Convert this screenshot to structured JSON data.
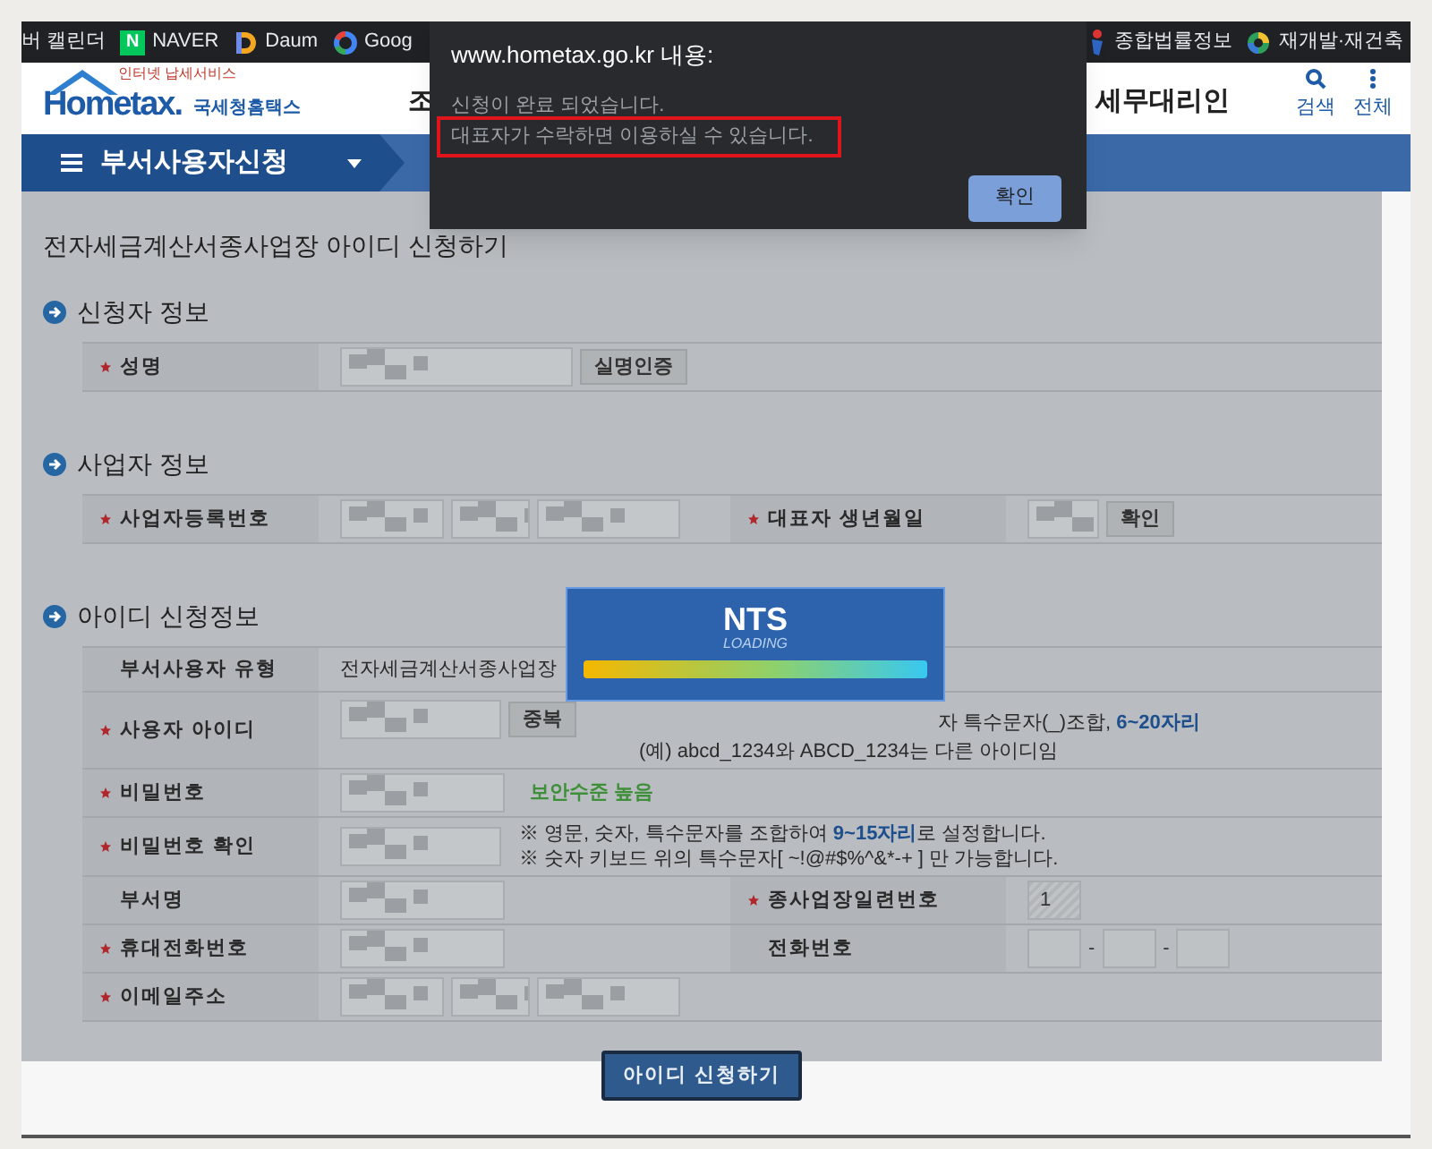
{
  "bookmarks": [
    {
      "label": "버 캘린더",
      "kind": "plain"
    },
    {
      "label": "NAVER",
      "kind": "naver",
      "badge": "N"
    },
    {
      "label": "Daum",
      "kind": "daum"
    },
    {
      "label": "Goog",
      "kind": "google"
    },
    {
      "label": "종합법률정보",
      "kind": "law"
    },
    {
      "label": "재개발·재건축",
      "kind": "swirl"
    }
  ],
  "header": {
    "tagline": "인터넷 납세서비스",
    "logo": "Hometax.",
    "logo_korean": "국세청홈택스",
    "menu": [
      "조",
      "세무대리인"
    ],
    "tools": [
      {
        "label": "검색",
        "kind": "search"
      },
      {
        "label": "전체",
        "kind": "more"
      }
    ]
  },
  "nav": {
    "title": "부서사용자신청"
  },
  "page": {
    "title": "전자세금계산서종사업장 아이디 신청하기",
    "sections": [
      {
        "title": "신청자 정보",
        "rows": [
          {
            "cells": [
              {
                "label": "성명",
                "required": true,
                "value": {
                  "kind": "masked",
                  "button": "실명인증"
                }
              }
            ]
          }
        ]
      },
      {
        "title": "사업자 정보",
        "rows": [
          {
            "cells": [
              {
                "label": "사업자등록번호",
                "required": true,
                "value": {
                  "kind": "masked_group"
                }
              },
              {
                "label": "대표자 생년월일",
                "required": true,
                "value": {
                  "kind": "masked",
                  "button": "확인"
                }
              }
            ]
          }
        ]
      },
      {
        "title": "아이디 신청정보",
        "rows": [
          {
            "cells": [
              {
                "label": "부서사용자 유형",
                "required": false,
                "value": {
                  "kind": "text",
                  "text": "전자세금계산서종사업장"
                }
              }
            ]
          },
          {
            "cells": [
              {
                "label": "사용자 아이디",
                "required": true,
                "value": {
                  "kind": "masked",
                  "button": "중복",
                  "hints": [
                    "자 특수문자(_)조합, **6~20자리**",
                    "(예) abcd_1234와  ABCD_1234는 다른 아이디임"
                  ]
                }
              }
            ]
          },
          {
            "cells": [
              {
                "label": "비밀번호",
                "required": true,
                "value": {
                  "kind": "masked",
                  "note": "보안수준 높음"
                }
              }
            ]
          },
          {
            "cells": [
              {
                "label": "비밀번호 확인",
                "required": true,
                "value": {
                  "kind": "masked",
                  "hints": [
                    "※ 영문, 숫자, 특수문자를 조합하여 **9~15자리**로 설정합니다.",
                    "※ 숫자 키보드 위의 특수문자[ ~!@#$%^&*-+ ] 만 가능합니다."
                  ]
                }
              }
            ]
          },
          {
            "cells": [
              {
                "label": "부서명",
                "required": false,
                "value": {
                  "kind": "masked"
                }
              },
              {
                "label": "종사업장일련번호",
                "required": true,
                "value": {
                  "kind": "input",
                  "value": "1",
                  "disabled": true
                }
              }
            ]
          },
          {
            "cells": [
              {
                "label": "휴대전화번호",
                "required": true,
                "value": {
                  "kind": "masked"
                }
              },
              {
                "label": "전화번호",
                "required": false,
                "value": {
                  "kind": "phone",
                  "separators": [
                    "-",
                    "-"
                  ]
                }
              }
            ]
          },
          {
            "cells": [
              {
                "label": "이메일주소",
                "required": true,
                "value": {
                  "kind": "masked_group"
                }
              }
            ]
          }
        ]
      }
    ],
    "submit": "아이디 신청하기"
  },
  "dialog": {
    "title": "www.hometax.go.kr 내용:",
    "lines": [
      {
        "text": "신청이 완료 되었습니다.",
        "highlighted": false
      },
      {
        "text": "대표자가 수락하면 이용하실 수 있습니다.",
        "highlighted": true
      }
    ],
    "button": "확인"
  },
  "loading": {
    "logo": "NTS",
    "caption": "LOADING",
    "level": 1
  }
}
